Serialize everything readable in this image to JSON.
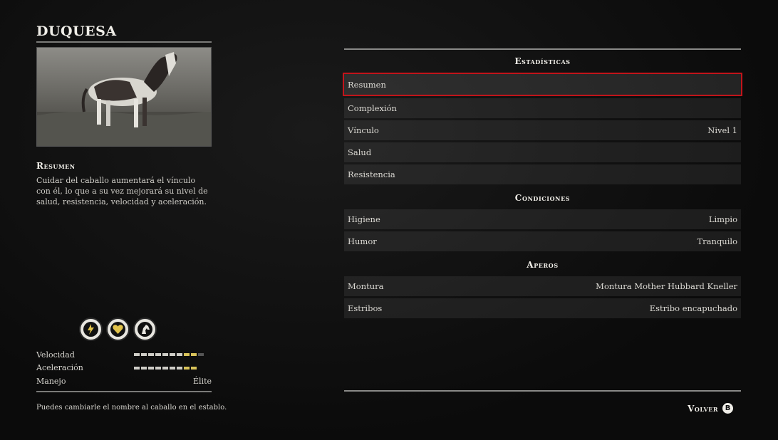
{
  "horse": {
    "name": "DUQUESA"
  },
  "summary": {
    "title": "Resumen",
    "text": "Cuidar del caballo aumentará el vínculo con él, lo que a su vez mejorará su nivel de salud, resistencia, velocidad y aceleración."
  },
  "cores": [
    {
      "icon": "stamina-core-icon"
    },
    {
      "icon": "health-core-icon"
    },
    {
      "icon": "horse-core-icon"
    }
  ],
  "attributes": [
    {
      "label": "Velocidad",
      "filled": 7,
      "gold": 2,
      "total": 10
    },
    {
      "label": "Aceleración",
      "filled": 7,
      "gold": 2,
      "total": 9
    },
    {
      "label": "Manejo",
      "value": "Élite"
    }
  ],
  "hint": "Puedes cambiarle el nombre al caballo en el establo.",
  "sections": [
    {
      "title": "Estadísticas",
      "rows": [
        {
          "label": "Resumen",
          "value": "",
          "selected": true
        },
        {
          "label": "Complexión",
          "value": ""
        },
        {
          "label": "Vínculo",
          "value": "Nivel 1"
        },
        {
          "label": "Salud",
          "value": ""
        },
        {
          "label": "Resistencia",
          "value": ""
        }
      ]
    },
    {
      "title": "Condiciones",
      "rows": [
        {
          "label": "Higiene",
          "value": "Limpio"
        },
        {
          "label": "Humor",
          "value": "Tranquilo"
        }
      ]
    },
    {
      "title": "Aperos",
      "rows": [
        {
          "label": "Montura",
          "value": "Montura Mother Hubbard Kneller"
        },
        {
          "label": "Estribos",
          "value": "Estribo encapuchado"
        }
      ]
    }
  ],
  "back": {
    "label": "Volver",
    "button": "B"
  },
  "colors": {
    "selection": "#c2141a",
    "bar_gold": "#d9c35a",
    "bar_white": "#cfcdc7"
  }
}
